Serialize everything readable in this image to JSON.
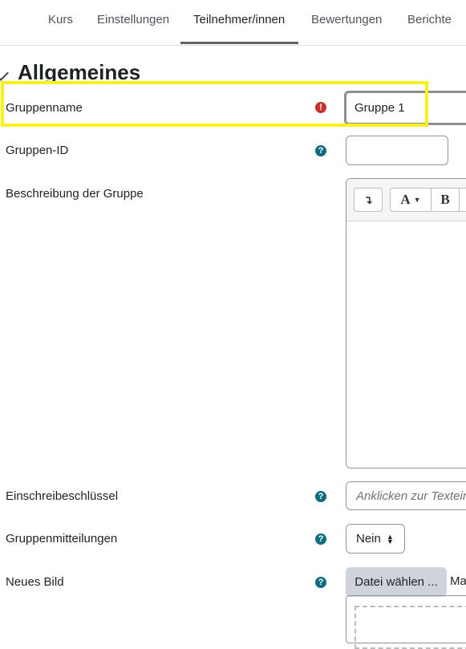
{
  "nav": {
    "tabs": [
      {
        "label": "Kurs"
      },
      {
        "label": "Einstellungen"
      },
      {
        "label": "Teilnehmer/innen"
      },
      {
        "label": "Bewertungen"
      },
      {
        "label": "Berichte"
      }
    ],
    "active_tab": "Teilnehmer/innen"
  },
  "section": {
    "title": "Allgemeines"
  },
  "form": {
    "group_name": {
      "label": "Gruppenname",
      "value": "Gruppe 1",
      "required_icon": "exclamation-icon"
    },
    "group_id": {
      "label": "Gruppen-ID",
      "value": "",
      "help_icon": "question-icon"
    },
    "description": {
      "label": "Beschreibung der Gruppe",
      "toolbar": {
        "collapse": "↴",
        "font": "A",
        "bold": "B"
      }
    },
    "enrol_key": {
      "label": "Einschreibeschlüssel",
      "placeholder": "Anklicken zur Texteing"
    },
    "group_messaging": {
      "label": "Gruppenmitteilungen",
      "selected": "Nein"
    },
    "new_image": {
      "label": "Neues Bild",
      "button": "Datei wählen ...",
      "max_size_text": "Ma"
    }
  },
  "colors": {
    "highlight": "#f7f21a",
    "help_icon": "#0f6e7d",
    "required_icon": "#c7342b"
  }
}
